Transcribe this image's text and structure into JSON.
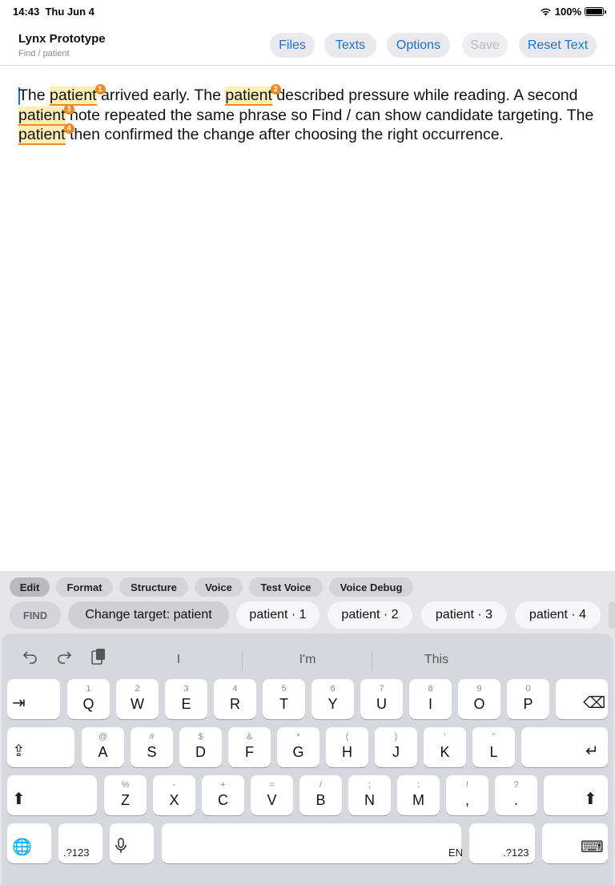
{
  "status": {
    "time": "14:43",
    "date": "Thu Jun 4",
    "battery": "100%",
    "battery_level": 1.0
  },
  "nav": {
    "title": "Lynx Prototype",
    "subtitle": "Find / patient",
    "buttons": {
      "files": "Files",
      "texts": "Texts",
      "options": "Options",
      "save": "Save",
      "reset": "Reset Text"
    }
  },
  "document": {
    "segments": [
      {
        "text": "The ",
        "hl": false
      },
      {
        "text": "patient",
        "hl": true,
        "badge": "1"
      },
      {
        "text": " arrived early. The ",
        "hl": false
      },
      {
        "text": "patient",
        "hl": true,
        "badge": "2"
      },
      {
        "text": " described pressure while reading. A second ",
        "hl": false
      },
      {
        "text": "patient",
        "hl": true,
        "badge": "3"
      },
      {
        "text": " note repeated the same phrase so Find / can show candidate targeting. The ",
        "hl": false
      },
      {
        "text": "patient",
        "hl": true,
        "badge": "4"
      },
      {
        "text": " then confirmed the change after choosing the right occurrence.",
        "hl": false
      }
    ]
  },
  "tabs": {
    "edit": "Edit",
    "format": "Format",
    "structure": "Structure",
    "voice": "Voice",
    "test_voice": "Test Voice",
    "voice_debug": "Voice Debug"
  },
  "chips": {
    "find": "FIND",
    "target": "Change target: patient",
    "c1": "patient · 1",
    "c2": "patient · 2",
    "c3": "patient · 3",
    "c4": "patient · 4"
  },
  "keyboard": {
    "predictions": [
      "I",
      "I'm",
      "This"
    ],
    "row1": [
      [
        "1",
        "Q"
      ],
      [
        "2",
        "W"
      ],
      [
        "3",
        "E"
      ],
      [
        "4",
        "R"
      ],
      [
        "5",
        "T"
      ],
      [
        "6",
        "Y"
      ],
      [
        "7",
        "U"
      ],
      [
        "8",
        "I"
      ],
      [
        "9",
        "O"
      ],
      [
        "0",
        "P"
      ]
    ],
    "row2": [
      [
        "@",
        "A"
      ],
      [
        "#",
        "S"
      ],
      [
        "$",
        "D"
      ],
      [
        "&",
        "F"
      ],
      [
        "*",
        "G"
      ],
      [
        "(",
        "H"
      ],
      [
        ")",
        "J"
      ],
      [
        "'",
        "K"
      ],
      [
        "\"",
        "L"
      ]
    ],
    "row3": [
      [
        "%",
        "Z"
      ],
      [
        "-",
        "X"
      ],
      [
        "+",
        "C"
      ],
      [
        "=",
        "V"
      ],
      [
        "/",
        "B"
      ],
      [
        ";",
        "N"
      ],
      [
        ":",
        "M"
      ],
      [
        "!",
        ","
      ],
      [
        "?",
        "."
      ]
    ],
    "numbers_label": ".?123",
    "lang": "EN"
  }
}
